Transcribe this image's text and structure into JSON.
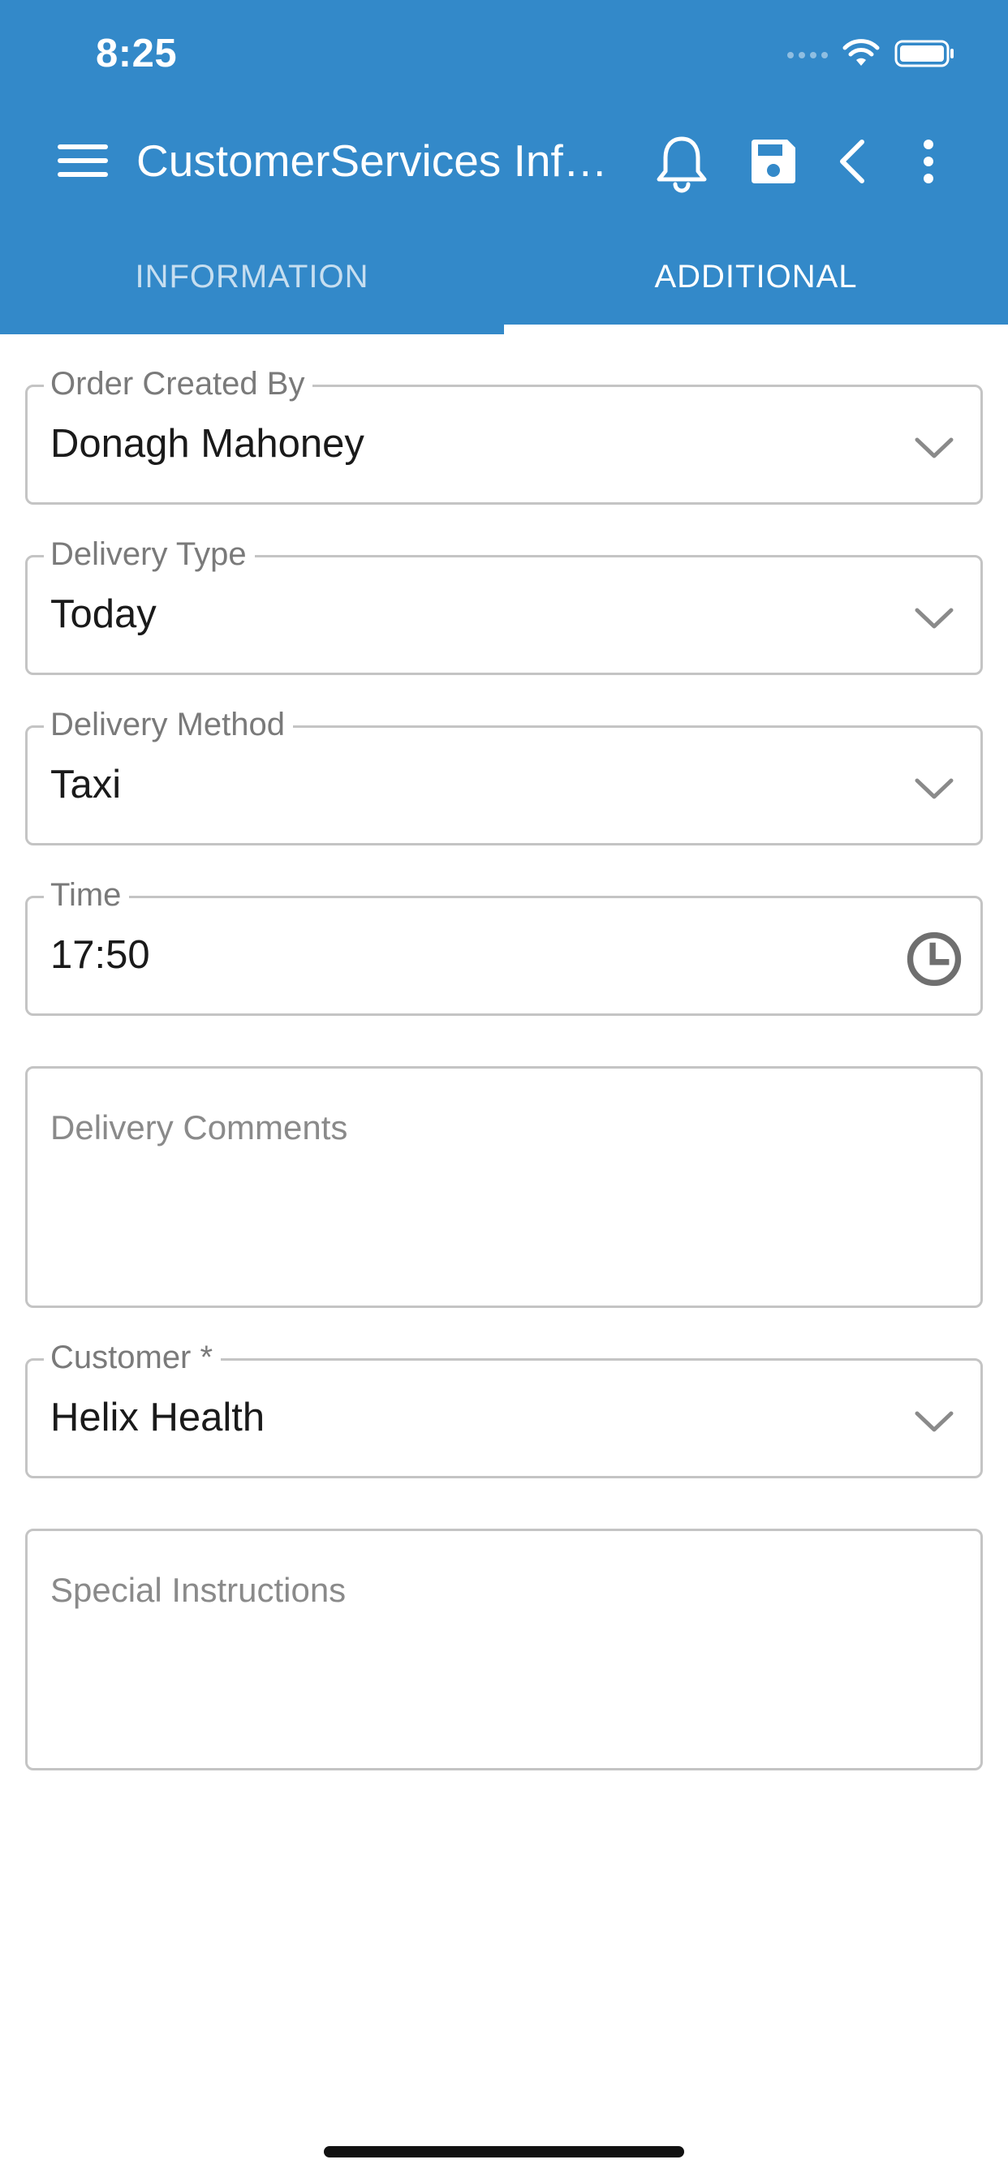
{
  "status_bar": {
    "time": "8:25"
  },
  "toolbar": {
    "title": "CustomerServices Infor...",
    "icons": [
      "menu-icon",
      "bell-icon",
      "save-icon",
      "back-icon",
      "more-vert-icon"
    ]
  },
  "tabs": [
    {
      "label": "INFORMATION",
      "active": false
    },
    {
      "label": "ADDITIONAL",
      "active": true
    }
  ],
  "form": {
    "order_created_by": {
      "label": "Order Created By",
      "value": "Donagh Mahoney"
    },
    "delivery_type": {
      "label": "Delivery Type",
      "value": "Today"
    },
    "delivery_method": {
      "label": "Delivery Method",
      "value": "Taxi"
    },
    "time": {
      "label": "Time",
      "value": "17:50"
    },
    "delivery_comments": {
      "placeholder": "Delivery Comments"
    },
    "customer": {
      "label": "Customer *",
      "value": "Helix Health"
    },
    "special_instructions": {
      "placeholder": "Special Instructions"
    }
  },
  "colors": {
    "primary": "#3389c9",
    "border": "#c4c4c4",
    "text": "#1a1a1a",
    "label": "#7a7a7a"
  }
}
